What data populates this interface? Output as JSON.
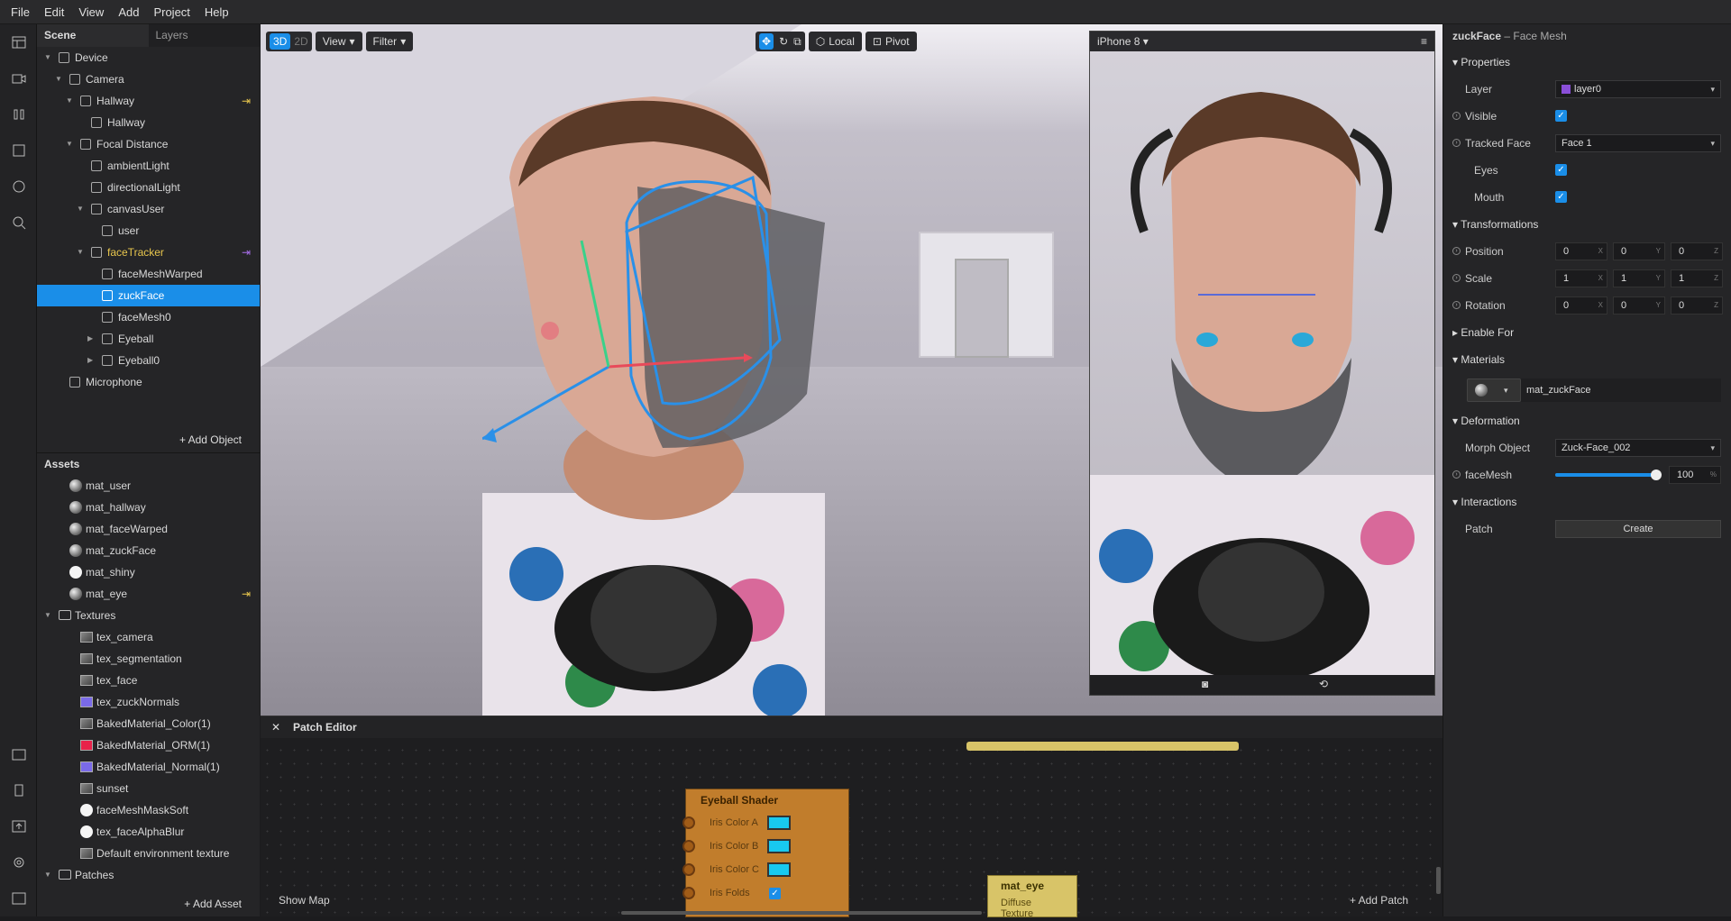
{
  "menu": [
    "File",
    "Edit",
    "View",
    "Add",
    "Project",
    "Help"
  ],
  "scene": {
    "tab_scene": "Scene",
    "tab_layers": "Layers",
    "items": [
      {
        "label": "Device",
        "indent": 0,
        "arrow": "down",
        "icon": "device-icon"
      },
      {
        "label": "Camera",
        "indent": 1,
        "arrow": "down",
        "icon": "camera-icon"
      },
      {
        "label": "Hallway",
        "indent": 2,
        "arrow": "down",
        "icon": "cube-icon",
        "pin": true
      },
      {
        "label": "Hallway",
        "indent": 3,
        "arrow": "",
        "icon": "mesh-icon"
      },
      {
        "label": "Focal Distance",
        "indent": 2,
        "arrow": "down",
        "icon": "focal-icon"
      },
      {
        "label": "ambientLight",
        "indent": 3,
        "arrow": "",
        "icon": "light-icon"
      },
      {
        "label": "directionalLight",
        "indent": 3,
        "arrow": "",
        "icon": "light-icon"
      },
      {
        "label": "canvasUser",
        "indent": 3,
        "arrow": "down",
        "icon": "canvas-icon"
      },
      {
        "label": "user",
        "indent": 4,
        "arrow": "",
        "icon": "rect-icon"
      },
      {
        "label": "faceTracker",
        "indent": 3,
        "arrow": "down",
        "icon": "facetracker-icon",
        "yellow": true,
        "pin": true
      },
      {
        "label": "faceMeshWarped",
        "indent": 4,
        "arrow": "",
        "icon": "facemesh-icon"
      },
      {
        "label": "zuckFace",
        "indent": 4,
        "arrow": "",
        "icon": "facemesh-icon",
        "selected": true
      },
      {
        "label": "faceMesh0",
        "indent": 4,
        "arrow": "",
        "icon": "facemesh-icon"
      },
      {
        "label": "Eyeball",
        "indent": 4,
        "arrow": "right",
        "icon": "cube-icon"
      },
      {
        "label": "Eyeball0",
        "indent": 4,
        "arrow": "right",
        "icon": "cube-icon"
      },
      {
        "label": "Microphone",
        "indent": 1,
        "arrow": "",
        "icon": "mic-icon"
      }
    ],
    "add_object": "Add Object"
  },
  "assets": {
    "header": "Assets",
    "items": [
      {
        "label": "mat_user",
        "kind": "sphere",
        "indent": 0
      },
      {
        "label": "mat_hallway",
        "kind": "sphere",
        "indent": 0
      },
      {
        "label": "mat_faceWarped",
        "kind": "sphere",
        "indent": 0
      },
      {
        "label": "mat_zuckFace",
        "kind": "sphere",
        "indent": 0
      },
      {
        "label": "mat_shiny",
        "kind": "white",
        "indent": 0
      },
      {
        "label": "mat_eye",
        "kind": "sphere",
        "indent": 0,
        "pin": true
      },
      {
        "label": "Textures",
        "kind": "folder",
        "indent": 0,
        "arrow": "down"
      },
      {
        "label": "tex_camera",
        "kind": "tex",
        "indent": 1
      },
      {
        "label": "tex_segmentation",
        "kind": "tex",
        "indent": 1
      },
      {
        "label": "tex_face",
        "kind": "tex",
        "indent": 1
      },
      {
        "label": "tex_zuckNormals",
        "kind": "purple",
        "indent": 1
      },
      {
        "label": "BakedMaterial_Color(1)",
        "kind": "tex",
        "indent": 1
      },
      {
        "label": "BakedMaterial_ORM(1)",
        "kind": "red",
        "indent": 1
      },
      {
        "label": "BakedMaterial_Normal(1)",
        "kind": "purple",
        "indent": 1
      },
      {
        "label": "sunset",
        "kind": "tex",
        "indent": 1
      },
      {
        "label": "faceMeshMaskSoft",
        "kind": "white",
        "indent": 1
      },
      {
        "label": "tex_faceAlphaBlur",
        "kind": "white",
        "indent": 1
      },
      {
        "label": "Default environment texture",
        "kind": "tex",
        "indent": 1
      },
      {
        "label": "Patches",
        "kind": "folder",
        "indent": 0,
        "arrow": "down"
      }
    ],
    "add_asset": "Add Asset"
  },
  "viewport": {
    "mode_3d": "3D",
    "mode_2d": "2D",
    "view": "View",
    "filter": "Filter",
    "local": "Local",
    "pivot": "Pivot"
  },
  "preview": {
    "device": "iPhone 8"
  },
  "patch_editor": {
    "title": "Patch Editor",
    "show_map": "Show Map",
    "add_patch": "Add Patch",
    "node_title": "Eyeball Shader",
    "ports": [
      "Iris Color A",
      "Iris Color B",
      "Iris Color C",
      "Iris Folds"
    ],
    "mat_node_title": "mat_eye",
    "mat_node_port": "Diffuse Texture"
  },
  "inspector": {
    "object_name": "zuckFace",
    "object_type": "– Face Mesh",
    "properties": "Properties",
    "layer_label": "Layer",
    "layer_value": "layer0",
    "visible_label": "Visible",
    "tracked_face_label": "Tracked Face",
    "tracked_face_value": "Face 1",
    "eyes_label": "Eyes",
    "mouth_label": "Mouth",
    "transformations": "Transformations",
    "position_label": "Position",
    "position": [
      "0",
      "0",
      "0"
    ],
    "scale_label": "Scale",
    "scale": [
      "1",
      "1",
      "1"
    ],
    "rotation_label": "Rotation",
    "rotation": [
      "0",
      "0",
      "0"
    ],
    "axes": [
      "X",
      "Y",
      "Z"
    ],
    "enable_for": "Enable For",
    "materials": "Materials",
    "material_value": "mat_zuckFace",
    "deformation": "Deformation",
    "morph_label": "Morph Object",
    "morph_value": "Zuck-Face_002",
    "facemesh_label": "faceMesh",
    "facemesh_value": "100",
    "facemesh_fraction": 1.0,
    "percent": "%",
    "interactions": "Interactions",
    "patch_label": "Patch",
    "create": "Create"
  }
}
